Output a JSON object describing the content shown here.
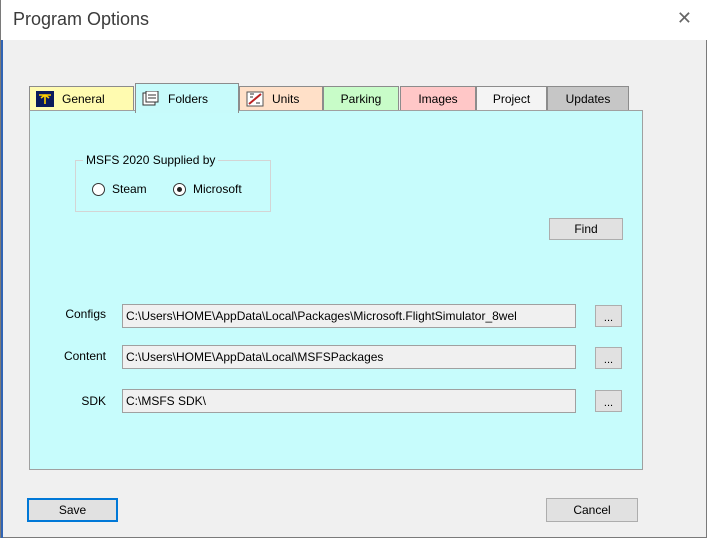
{
  "window": {
    "title": "Program Options",
    "close_glyph": "✕"
  },
  "tabs": [
    {
      "label": "General",
      "icon": "general-icon",
      "color": "#fffbb0"
    },
    {
      "label": "Folders",
      "icon": "folders-icon",
      "color": "#c7fbfb",
      "selected": true
    },
    {
      "label": "Units",
      "icon": "units-icon",
      "color": "#ffe0c8"
    },
    {
      "label": "Parking",
      "color": "#c8fcc8"
    },
    {
      "label": "Images",
      "color": "#ffc7c7"
    },
    {
      "label": "Project",
      "color": "#f4f4f4"
    },
    {
      "label": "Updates",
      "color": "#c6c6c6"
    }
  ],
  "supplied_by": {
    "label": "MSFS 2020 Supplied by",
    "options": [
      {
        "label": "Steam",
        "checked": false
      },
      {
        "label": "Microsoft",
        "checked": true
      }
    ]
  },
  "find_button": "Find",
  "fields": {
    "configs": {
      "label": "Configs",
      "value": "C:\\Users\\HOME\\AppData\\Local\\Packages\\Microsoft.FlightSimulator_8wel"
    },
    "content": {
      "label": "Content",
      "value": "C:\\Users\\HOME\\AppData\\Local\\MSFSPackages"
    },
    "sdk": {
      "label": "SDK",
      "value": "C:\\MSFS SDK\\"
    }
  },
  "browse_label": "...",
  "buttons": {
    "save": "Save",
    "cancel": "Cancel"
  }
}
